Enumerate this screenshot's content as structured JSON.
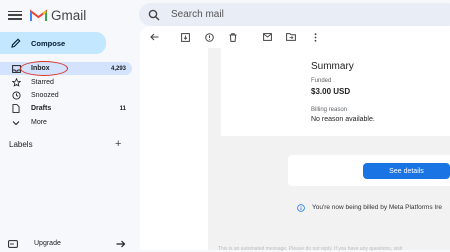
{
  "app": {
    "name": "Gmail"
  },
  "search": {
    "placeholder": "Search mail"
  },
  "sidebar": {
    "compose_label": "Compose",
    "items": [
      {
        "label": "Inbox",
        "count": "4,293",
        "icon": "inbox-icon"
      },
      {
        "label": "Starred",
        "icon": "star-icon"
      },
      {
        "label": "Snoozed",
        "icon": "clock-icon"
      },
      {
        "label": "Drafts",
        "count": "11",
        "icon": "draft-icon"
      },
      {
        "label": "More",
        "icon": "chevron-down-icon"
      }
    ],
    "labels_title": "Labels",
    "upgrade_label": "Upgrade"
  },
  "toolbar": {
    "icons": [
      "back-icon",
      "archive-icon",
      "report-icon",
      "delete-icon",
      "mark-unread-icon",
      "move-to-icon",
      "more-options-icon"
    ]
  },
  "email": {
    "summary_title": "Summary",
    "funded_label": "Funded",
    "funded_value": "$3.00 USD",
    "billing_reason_label": "Billing reason",
    "billing_reason_value": "No reason available.",
    "see_details_label": "See details",
    "billing_notice": "You're now being billed by Meta Platforms Ire",
    "footer_text": "This is an automated message. Please do not reply. If you have any questions, visit"
  },
  "colors": {
    "accent": "#1b74e4",
    "compose_bg": "#c2e7ff",
    "inbox_active_bg": "#d3e3fd",
    "annotation_circle": "#d93025",
    "gmail_red": "#ea4335"
  }
}
